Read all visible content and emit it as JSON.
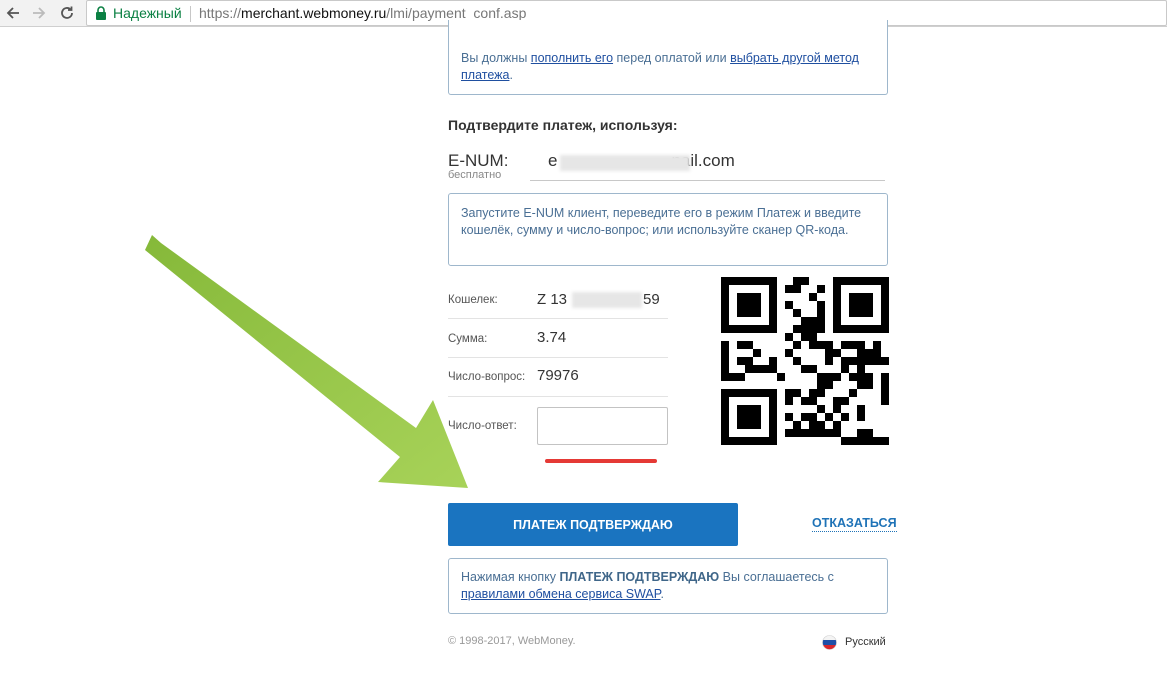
{
  "browser": {
    "secure_label": "Надежный",
    "url_scheme": "https://",
    "url_host": "merchant.webmoney.ru",
    "url_path": "/lmi/payment_conf.asp"
  },
  "notice": {
    "prefix": "Вы должны ",
    "link_topup": "пополнить его",
    "middle": " перед оплатой или ",
    "link_other_method": "выбрать другой метод платежа",
    "suffix": "."
  },
  "confirm_title": "Подтвердите платеж, используя:",
  "enum": {
    "label": "E-NUM:",
    "sublabel": "бесплатно",
    "value_start": "e",
    "value_end": "nail.com"
  },
  "enum_info": "Запустите E-NUM клиент, переведите его в режим Платеж и введите кошелёк, сумму и число-вопрос; или используйте сканер QR-кода.",
  "payment": {
    "wallet_label": "Кошелек:",
    "wallet_value_start": "Z  13",
    "wallet_value_end": "59",
    "amount_label": "Сумма:",
    "amount_value": "3.74",
    "question_label": "Число-вопрос:",
    "question_value": "79976",
    "answer_label": "Число-ответ:",
    "answer_value": ""
  },
  "buttons": {
    "confirm_label": "ПЛАТЕЖ ПОДТВЕРЖДАЮ",
    "cancel_label": "ОТКАЗАТЬСЯ"
  },
  "agreement": {
    "prefix": "Нажимая кнопку ",
    "button_name": "ПЛАТЕЖ ПОДТВЕРЖДАЮ",
    "middle": " Вы соглашаетесь с ",
    "link": "правилами обмена сервиса SWAP",
    "suffix": "."
  },
  "footer": {
    "copyright": "© 1998-2017, WebMoney.",
    "language": "Русский"
  },
  "colors": {
    "primary_button": "#1a74c0",
    "secure_green": "#0b8043",
    "arrow_green": "#8dc43f",
    "underline_red": "#e53935"
  }
}
